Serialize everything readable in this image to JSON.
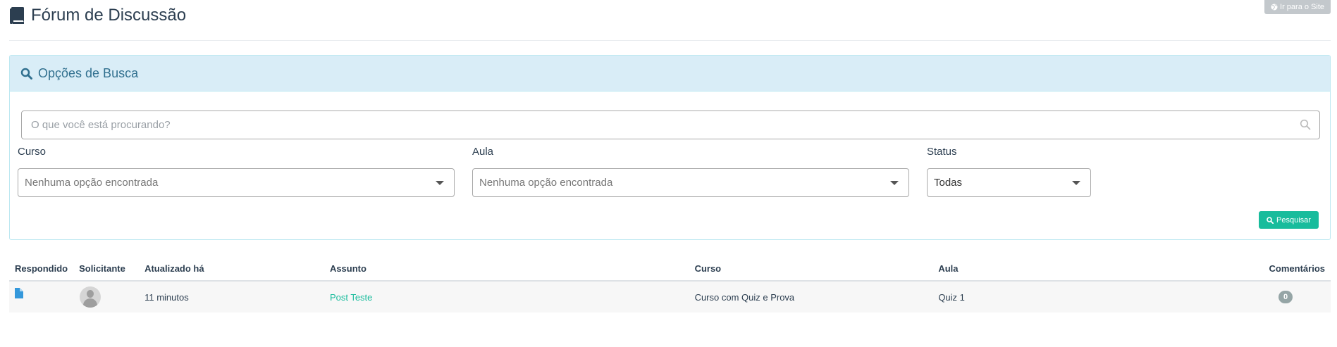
{
  "header": {
    "title": "Fórum de Discussão",
    "site_button_label": "Ir para o Site"
  },
  "search_panel": {
    "title": "Opções de Busca",
    "search_placeholder": "O que você está procurando?",
    "course": {
      "label": "Curso",
      "placeholder": "Nenhuma opção encontrada"
    },
    "lesson": {
      "label": "Aula",
      "placeholder": "Nenhuma opção encontrada"
    },
    "status": {
      "label": "Status",
      "value": "Todas"
    },
    "search_button_label": "Pesquisar"
  },
  "table": {
    "columns": [
      "Respondido",
      "Solicitante",
      "Atualizado há",
      "Assunto",
      "Curso",
      "Aula",
      "Comentários"
    ],
    "rows": [
      {
        "answered_icon": "file-icon",
        "requester_avatar": "avatar-placeholder",
        "updated": "11 minutos",
        "subject": "Post Teste",
        "course": "Curso com Quiz e Prova",
        "lesson": "Quiz 1",
        "comments": "0"
      }
    ]
  },
  "colors": {
    "panel_heading_bg": "#d9edf7",
    "panel_heading_text": "#31708f",
    "accent": "#18bc9c",
    "answered_icon": "#3498db",
    "badge": "#95a5a6"
  }
}
